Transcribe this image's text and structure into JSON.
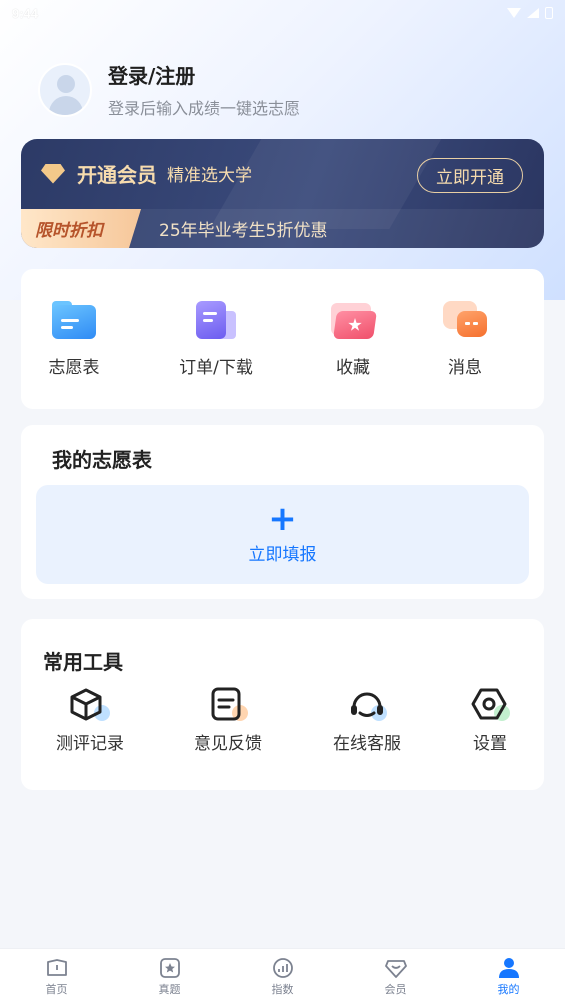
{
  "status": {
    "time": "9:44"
  },
  "profile": {
    "title": "登录/注册",
    "subtitle": "登录后输入成绩一键选志愿"
  },
  "vip": {
    "title": "开通会员",
    "subtitle": "精准选大学",
    "button": "立即开通",
    "discount_tag": "限时折扣",
    "discount_text": "25年毕业考生5折优惠",
    "accent_color": "#f7dcae"
  },
  "quick": [
    {
      "label": "志愿表",
      "icon": "folder-icon"
    },
    {
      "label": "订单/下载",
      "icon": "order-icon"
    },
    {
      "label": "收藏",
      "icon": "star-folder-icon"
    },
    {
      "label": "消息",
      "icon": "message-icon"
    }
  ],
  "wish": {
    "title": "我的志愿表",
    "plus": "+",
    "fill_label": "立即填报"
  },
  "tools": {
    "title": "常用工具",
    "items": [
      {
        "label": "测评记录",
        "icon": "cube-icon"
      },
      {
        "label": "意见反馈",
        "icon": "feedback-icon"
      },
      {
        "label": "在线客服",
        "icon": "headset-icon"
      },
      {
        "label": "设置",
        "icon": "settings-icon"
      }
    ]
  },
  "tabs": [
    {
      "label": "首页",
      "icon": "home-icon"
    },
    {
      "label": "真题",
      "icon": "exam-icon"
    },
    {
      "label": "指数",
      "icon": "chart-icon"
    },
    {
      "label": "会员",
      "icon": "vip-icon"
    },
    {
      "label": "我的",
      "icon": "user-icon",
      "active": true
    }
  ],
  "colors": {
    "primary": "#1677ff",
    "vip_bg": "#2c3a66"
  }
}
